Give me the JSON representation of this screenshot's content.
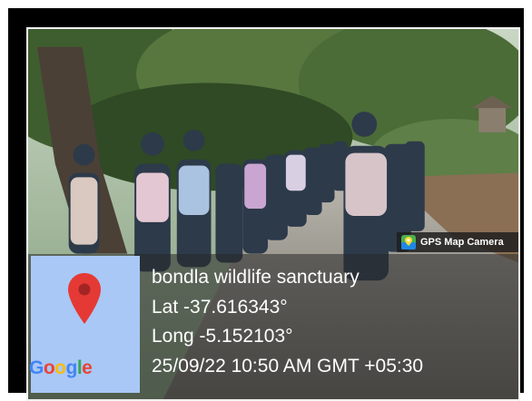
{
  "watermark": {
    "app_label": "GPS Map Camera",
    "icon": "gps-map-camera-icon"
  },
  "location": {
    "place": "bondla wildlife sanctuary",
    "latitude": "Lat -37.616343°",
    "longitude": "Long -5.152103°",
    "timestamp": "25/09/22 10:50 AM GMT +05:30"
  },
  "map": {
    "logo": "Google",
    "pin_icon": "map-pin-icon",
    "background_color": "#a9c8f5",
    "pin_color": "#e53935"
  }
}
